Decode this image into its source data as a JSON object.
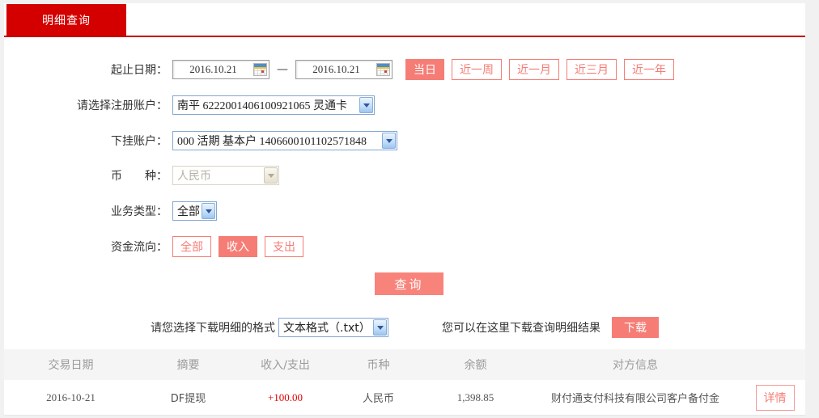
{
  "tab": {
    "label": "明细查询"
  },
  "form": {
    "date_row": {
      "label": "起止日期：",
      "start_date": "2016.10.21",
      "end_date": "2016.10.21",
      "separator": "—",
      "quick_buttons": [
        {
          "label": "当日",
          "active": true
        },
        {
          "label": "近一周",
          "active": false
        },
        {
          "label": "近一月",
          "active": false
        },
        {
          "label": "近三月",
          "active": false
        },
        {
          "label": "近一年",
          "active": false
        }
      ]
    },
    "register_account": {
      "label": "请选择注册账户：",
      "value": "南平 6222001406100921065 灵通卡"
    },
    "sub_account": {
      "label": "下挂账户：",
      "value": "000 活期 基本户 1406600101102571848"
    },
    "currency": {
      "label": "币　　种：",
      "value": "人民币",
      "disabled": true
    },
    "business_type": {
      "label": "业务类型：",
      "value": "全部"
    },
    "fund_flow": {
      "label": "资金流向：",
      "options": [
        {
          "label": "全部",
          "active": false
        },
        {
          "label": "收入",
          "active": true
        },
        {
          "label": "支出",
          "active": false
        }
      ]
    },
    "query_button": "查询"
  },
  "download": {
    "format_label": "请您选择下载明细的格式",
    "format_value": "文本格式（.txt）",
    "hint": "您可以在这里下载查询明细结果",
    "button": "下载"
  },
  "table": {
    "headers": [
      "交易日期",
      "摘要",
      "收入/支出",
      "币种",
      "余额",
      "对方信息"
    ],
    "rows": [
      {
        "date": "2016-10-21",
        "summary": "DF提现",
        "amount": "+100.00",
        "currency": "人民币",
        "balance": "1,398.85",
        "counterparty": "财付通支付科技有限公司客户备付金",
        "action": "详情"
      }
    ]
  },
  "colors": {
    "brand_red": "#d40000",
    "salmon": "#f57d76",
    "amount_red": "#e60000"
  }
}
